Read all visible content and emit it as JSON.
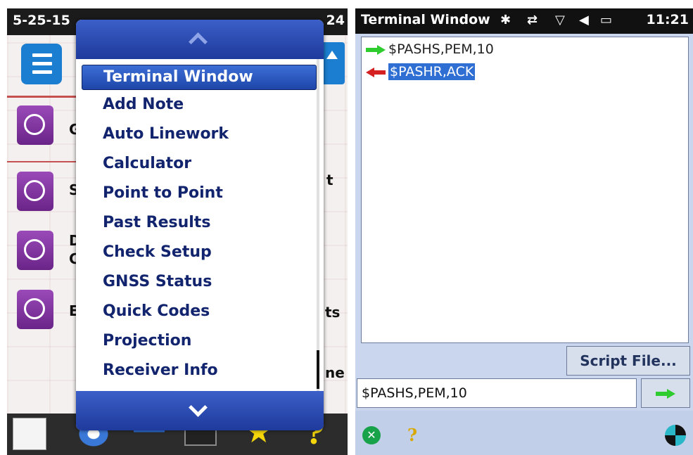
{
  "left_screen": {
    "status": {
      "date": "5-25-15",
      "time_fragment": "24"
    },
    "menu": {
      "items": [
        "Terminal Window",
        "Add Note",
        "Auto Linework",
        "Calculator",
        "Point to Point",
        "Past Results",
        "Check Setup",
        "GNSS Status",
        "Quick Codes",
        "Projection",
        "Receiver Info"
      ],
      "selected_index": 0
    },
    "background_fragments": {
      "g": "G",
      "s": "S",
      "d": "D",
      "c": "C",
      "e": "E",
      "t": "t",
      "ts": "ts",
      "ne": "ne"
    }
  },
  "right_screen": {
    "status": {
      "title": "Terminal Window",
      "time": "11:21"
    },
    "terminal_lines": [
      {
        "direction": "sent",
        "text": "$PASHS,PEM,10"
      },
      {
        "direction": "received",
        "text": "$PASHR,ACK"
      }
    ],
    "script_file_label": "Script File...",
    "command_input_value": "$PASHS,PEM,10"
  },
  "colors": {
    "menu_bar": "#2a4bb4",
    "menu_text": "#12246e",
    "selection": "#2f6fd4",
    "send_arrow": "#2ecc2e",
    "receive_arrow": "#d42020"
  }
}
